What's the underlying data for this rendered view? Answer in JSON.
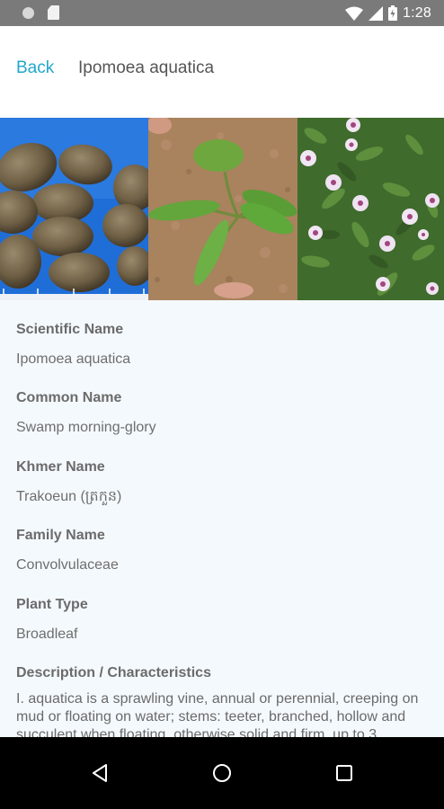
{
  "status_bar": {
    "time": "1:28"
  },
  "header": {
    "back_label": "Back",
    "title": "Ipomoea aquatica"
  },
  "gallery": {
    "images": [
      {
        "name": "seeds-photo"
      },
      {
        "name": "seedling-photo"
      },
      {
        "name": "flowers-photo"
      }
    ]
  },
  "details": {
    "scientific_name": {
      "label": "Scientific Name",
      "value": "Ipomoea aquatica"
    },
    "common_name": {
      "label": "Common Name",
      "value": "Swamp morning-glory"
    },
    "khmer_name": {
      "label": "Khmer Name",
      "value": "Trakoeun (ត្រកួន)"
    },
    "family_name": {
      "label": "Family Name",
      "value": "Convolvulaceae"
    },
    "plant_type": {
      "label": "Plant Type",
      "value": "Broadleaf"
    },
    "description": {
      "label": "Description / Characteristics",
      "value": "I. aquatica is a sprawling vine, annual or perennial, creeping on mud or floating on water; stems: teeter, branched, hollow and succulent when floating, otherwise solid and firm, up to 3"
    }
  },
  "colors": {
    "accent": "#22a7c9",
    "status_bar": "#7a7a7a",
    "details_bg": "#f4f9fd",
    "nav_bar": "#000000"
  },
  "icons": [
    "notification-dot-icon",
    "sd-card-icon",
    "wifi-icon",
    "signal-icon",
    "battery-icon",
    "back-triangle-icon",
    "home-circle-icon",
    "recents-square-icon"
  ]
}
